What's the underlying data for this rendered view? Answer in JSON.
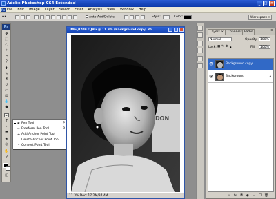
{
  "titlebar": {
    "title": "Adobe Photoshop CS4 Extended",
    "minimize": "_",
    "maximize": "□",
    "close": "×"
  },
  "menubar": {
    "logo": "Ps",
    "items": [
      "File",
      "Edit",
      "Image",
      "Layer",
      "Select",
      "Filter",
      "Analysis",
      "View",
      "Window",
      "Help"
    ]
  },
  "options": {
    "auto_add_delete": "Auto Add/Delete",
    "style": "Style:",
    "color": "Color:",
    "workspace": "Workspace ▾"
  },
  "toolbox": {
    "logo": "Ps"
  },
  "document": {
    "title": "IMG_0709 c.JPG @ 11.3% (Background copy, RG...",
    "status": "11.3%  Doc: 17.2M/34.4M"
  },
  "pen_flyout": {
    "items": [
      {
        "label": "Pen Tool",
        "shortcut": "P",
        "selected": true
      },
      {
        "label": "Freeform Pen Tool",
        "shortcut": "P",
        "selected": false
      },
      {
        "label": "Add Anchor Point Tool",
        "shortcut": "",
        "selected": false
      },
      {
        "label": "Delete Anchor Point Tool",
        "shortcut": "",
        "selected": false
      },
      {
        "label": "Convert Point Tool",
        "shortcut": "",
        "selected": false
      }
    ]
  },
  "layers_panel": {
    "tabs": [
      "Layers ×",
      "Channels",
      "Paths"
    ],
    "blend_mode": "Normal",
    "opacity_label": "Opacity:",
    "opacity": "100%",
    "lock_label": "Lock:",
    "fill_label": "Fill:",
    "fill": "100%",
    "layers": [
      {
        "name": "Background copy",
        "selected": true
      },
      {
        "name": "Background",
        "selected": false
      }
    ]
  },
  "colors": {
    "accent_title": "#0b38a8",
    "selection": "#3169c6",
    "arrow": "#e01818"
  }
}
